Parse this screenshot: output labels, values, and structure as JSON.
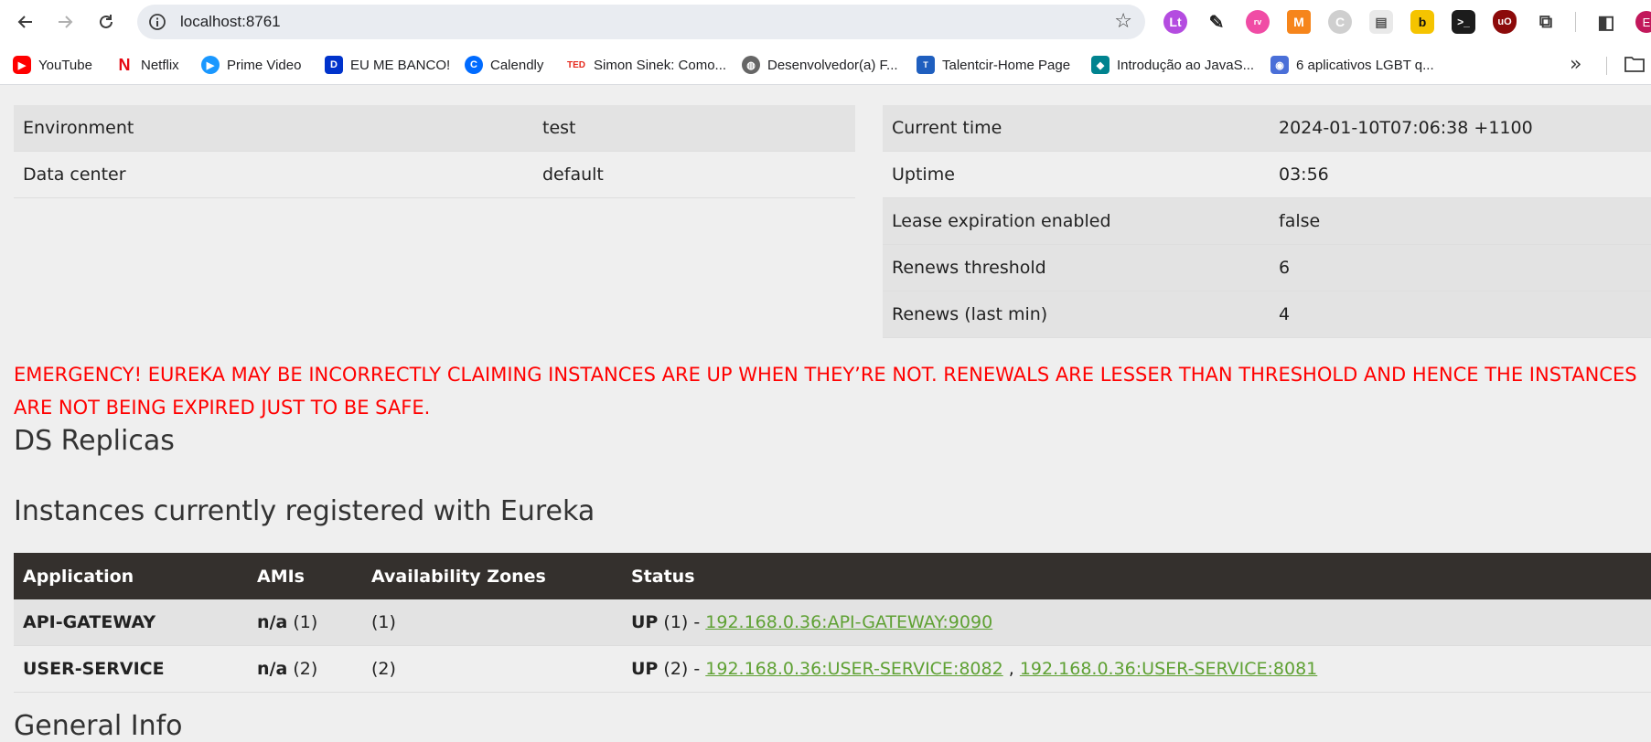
{
  "browser": {
    "url": "localhost:8761",
    "bookmarks": [
      {
        "label": "YouTube",
        "icon": "youtube-icon"
      },
      {
        "label": "Netflix",
        "icon": "netflix-icon"
      },
      {
        "label": "Prime Video",
        "icon": "prime-video-icon"
      },
      {
        "label": "EU ME BANCO!",
        "icon": "bank-icon"
      },
      {
        "label": "Calendly",
        "icon": "calendly-icon"
      },
      {
        "label": "Simon Sinek: Como...",
        "icon": "ted-icon"
      },
      {
        "label": "Desenvolvedor(a) F...",
        "icon": "globe-icon"
      },
      {
        "label": "Talentcir-Home Page",
        "icon": "talentcir-icon"
      },
      {
        "label": "Introdução ao JavaS...",
        "icon": "bookmark-icon"
      },
      {
        "label": "6 aplicativos LGBT q...",
        "icon": "location-icon"
      }
    ],
    "extensions": [
      "translate-extension-icon",
      "eyedropper-extension-icon",
      "reeve-extension-icon",
      "metamask-extension-icon",
      "grey-extension-icon",
      "tab-extension-icon",
      "b-extension-icon",
      "terminal-extension-icon",
      "ublock-extension-icon",
      "puzzle-extensions-icon"
    ],
    "profile_initial": "E"
  },
  "environment": {
    "rows": [
      {
        "key": "Environment",
        "value": "test"
      },
      {
        "key": "Data center",
        "value": "default"
      }
    ]
  },
  "status": {
    "rows": [
      {
        "key": "Current time",
        "value": "2024-01-10T07:06:38 +1100"
      },
      {
        "key": "Uptime",
        "value": "03:56"
      },
      {
        "key": "Lease expiration enabled",
        "value": "false"
      },
      {
        "key": "Renews threshold",
        "value": "6"
      },
      {
        "key": "Renews (last min)",
        "value": "4"
      }
    ]
  },
  "emergency": "EMERGENCY! EUREKA MAY BE INCORRECTLY CLAIMING INSTANCES ARE UP WHEN THEY’RE NOT. RENEWALS ARE LESSER THAN THRESHOLD AND HENCE THE INSTANCES ARE NOT BEING EXPIRED JUST TO BE SAFE.",
  "headings": {
    "ds_replicas": "DS Replicas",
    "instances": "Instances currently registered with Eureka",
    "general_info": "General Info"
  },
  "instances": {
    "columns": [
      "Application",
      "AMIs",
      "Availability Zones",
      "Status"
    ],
    "rows": [
      {
        "application": "API-GATEWAY",
        "amis_label": "n/a",
        "amis_count": "(1)",
        "zones": "(1)",
        "status_label": "UP",
        "status_count": "(1) -",
        "links": [
          "192.168.0.36:API-GATEWAY:9090"
        ]
      },
      {
        "application": "USER-SERVICE",
        "amis_label": "n/a",
        "amis_count": "(2)",
        "zones": "(2)",
        "status_label": "UP",
        "status_count": "(2) -",
        "links": [
          "192.168.0.36:USER-SERVICE:8082",
          "192.168.0.36:USER-SERVICE:8081"
        ],
        "link_separator": ","
      }
    ]
  },
  "colors": {
    "emergency": "#ff0000",
    "table_header": "#34302d",
    "link": "#5fa134",
    "page_bg": "#efefef"
  }
}
